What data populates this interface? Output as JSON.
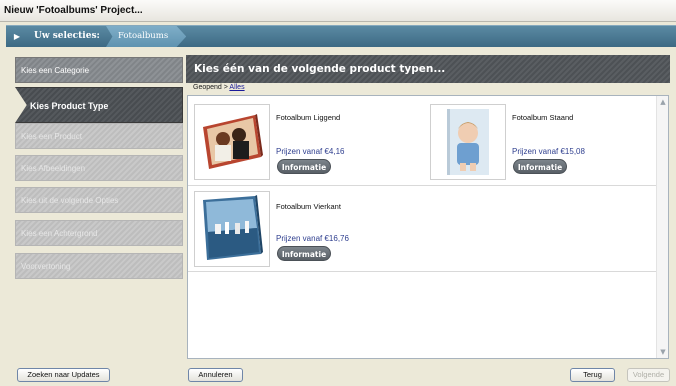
{
  "window": {
    "title": "Nieuw 'Fotoalbums' Project..."
  },
  "steps_bar": {
    "label": "Uw selecties:",
    "crumb": "Fotoalbums",
    "arrow_icon": "play-arrow-icon"
  },
  "sidebar": {
    "items": [
      {
        "label": "Kies een Categorie",
        "state": "done"
      },
      {
        "label": "Kies Product Type",
        "state": "active"
      },
      {
        "label": "Kies een Product",
        "state": "disabled"
      },
      {
        "label": "Kies Afbeeldingen",
        "state": "disabled"
      },
      {
        "label": "Kies uit de volgende Opties",
        "state": "disabled"
      },
      {
        "label": "Kies een Achtergrond",
        "state": "disabled"
      },
      {
        "label": "Voorvertoning",
        "state": "disabled"
      }
    ]
  },
  "main": {
    "header": "Kies één van de volgende product typen...",
    "breadcrumb": {
      "prefix": "Geopend >",
      "link": "Alles"
    },
    "products": [
      {
        "name": "Fotoalbum Liggend",
        "price": "Prijzen vanaf €4,16",
        "button": "Informatie"
      },
      {
        "name": "Fotoalbum Staand",
        "price": "Prijzen vanaf €15,08",
        "button": "Informatie"
      },
      {
        "name": "Fotoalbum Vierkant",
        "price": "Prijzen vanaf €16,76",
        "button": "Informatie"
      }
    ]
  },
  "footer": {
    "updates": "Zoeken naar Updates",
    "cancel": "Annuleren",
    "back": "Terug",
    "next": "Volgende"
  },
  "colors": {
    "accent": "#3d6a84",
    "price": "#2f3f8f",
    "header_bg": "#54585c"
  }
}
